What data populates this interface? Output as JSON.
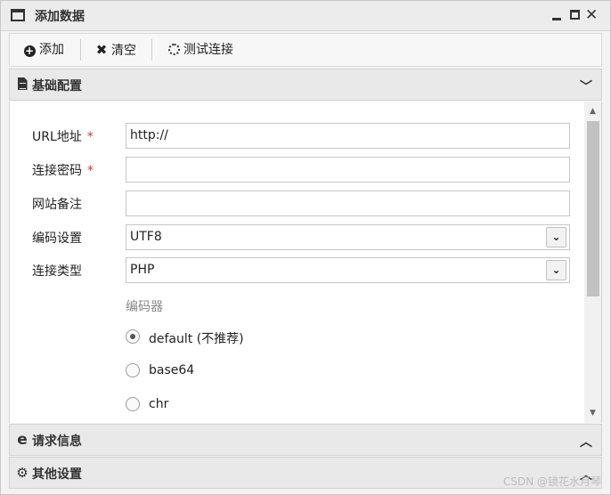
{
  "window": {
    "title": "添加数据"
  },
  "toolbar": {
    "add_label": "添加",
    "clear_label": "清空",
    "test_label": "测试连接"
  },
  "sections": {
    "basic": {
      "title": "基础配置",
      "state": "expanded"
    },
    "request": {
      "title": "请求信息",
      "state": "collapsed"
    },
    "other": {
      "title": "其他设置",
      "state": "collapsed"
    }
  },
  "form": {
    "url": {
      "label": "URL地址",
      "required_mark": "*",
      "value": "http://"
    },
    "password": {
      "label": "连接密码",
      "required_mark": "*",
      "value": ""
    },
    "note": {
      "label": "网站备注",
      "value": ""
    },
    "encoding": {
      "label": "编码设置",
      "value": "UTF8"
    },
    "type": {
      "label": "连接类型",
      "value": "PHP"
    },
    "encoder": {
      "label": "编码器",
      "options": [
        {
          "label": "default (不推荐)",
          "checked": true
        },
        {
          "label": "base64",
          "checked": false
        },
        {
          "label": "chr",
          "checked": false
        }
      ]
    }
  },
  "watermark": "CSDN @镜花水月琴"
}
